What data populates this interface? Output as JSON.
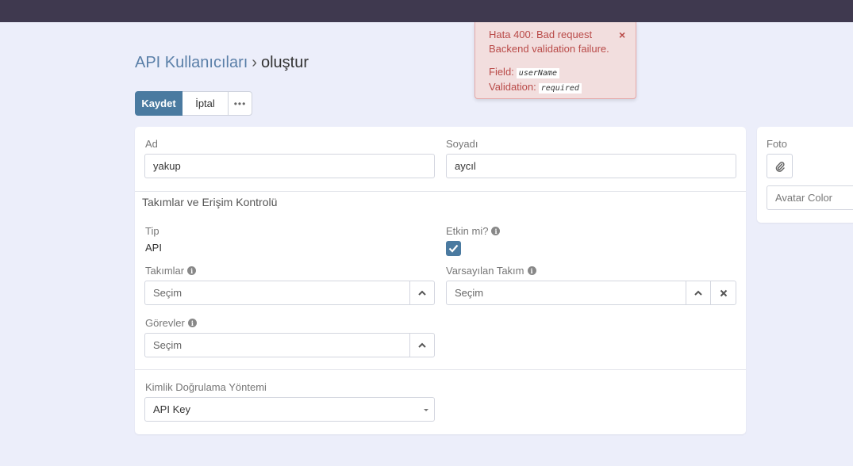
{
  "breadcrumb": {
    "parent": "API Kullanıcıları",
    "separator": "›",
    "current": "oluştur"
  },
  "toolbar": {
    "save_label": "Kaydet",
    "cancel_label": "İptal",
    "more_label": "•••"
  },
  "form": {
    "first_name": {
      "label": "Ad",
      "value": "yakup"
    },
    "last_name": {
      "label": "Soyadı",
      "value": "aycıl"
    },
    "section_title": "Takımlar ve Erişim Kontrolü",
    "type": {
      "label": "Tip",
      "value": "API"
    },
    "active": {
      "label": "Etkin mi?",
      "checked": true
    },
    "teams": {
      "label": "Takımlar",
      "placeholder": "Seçim"
    },
    "default_team": {
      "label": "Varsayılan Takım",
      "placeholder": "Seçim"
    },
    "roles": {
      "label": "Görevler",
      "placeholder": "Seçim"
    },
    "auth_method": {
      "label": "Kimlik Doğrulama Yöntemi",
      "value": "API Key"
    }
  },
  "side": {
    "photo_label": "Foto",
    "avatar_color_placeholder": "Avatar Color"
  },
  "toast": {
    "title": "Hata 400: Bad request",
    "message": "Backend validation failure.",
    "field_label": "Field:",
    "field_value": "userName",
    "validation_label": "Validation:",
    "validation_value": "required",
    "close_label": "×"
  },
  "icons": {
    "info": "info-icon",
    "chevron": "chevron-up-icon",
    "clear": "close-icon",
    "attach": "paperclip-icon",
    "check": "checkmark-icon"
  },
  "colors": {
    "primary": "#4a7aa0",
    "topbar": "#3f394f",
    "background": "#eceefa",
    "error_bg": "#f2dede",
    "error_text": "#b94a48"
  }
}
